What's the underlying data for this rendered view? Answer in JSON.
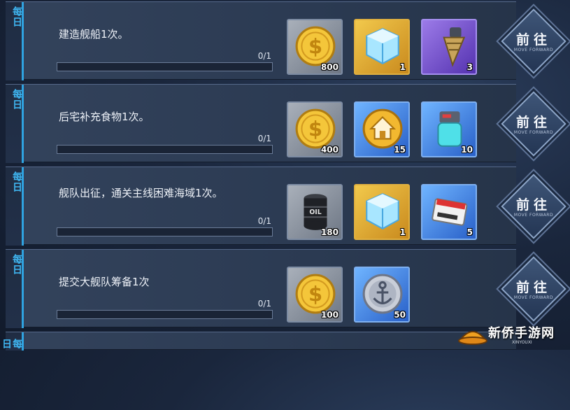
{
  "rows": [
    {
      "tag": "每日",
      "task": "建造舰船1次。",
      "progress": "0/1",
      "progress_fraction": 0,
      "rewards": [
        {
          "icon": "gold-coin-icon",
          "quantity": "800"
        },
        {
          "icon": "ice-cube-icon",
          "quantity": "1"
        },
        {
          "icon": "drill-icon",
          "quantity": "3"
        }
      ],
      "button": {
        "label": "前往",
        "sublabel": "MOVE FORWARD"
      }
    },
    {
      "tag": "每日",
      "task": "后宅补充食物1次。",
      "progress": "0/1",
      "progress_fraction": 0,
      "rewards": [
        {
          "icon": "gold-coin-icon",
          "quantity": "400"
        },
        {
          "icon": "home-icon",
          "quantity": "15"
        },
        {
          "icon": "canister-icon",
          "quantity": "10"
        }
      ],
      "button": {
        "label": "前往",
        "sublabel": "MOVE FORWARD"
      }
    },
    {
      "tag": "每日",
      "task": "舰队出征，通关主线困难海域1次。",
      "progress": "0/1",
      "progress_fraction": 0,
      "rewards": [
        {
          "icon": "oil-barrel-icon",
          "quantity": "180"
        },
        {
          "icon": "ice-cube-icon",
          "quantity": "1"
        },
        {
          "icon": "core-data-icon",
          "quantity": "5"
        }
      ],
      "button": {
        "label": "前往",
        "sublabel": "MOVE FORWARD"
      }
    },
    {
      "tag": "每日",
      "task": "提交大舰队筹备1次",
      "progress": "0/1",
      "progress_fraction": 0,
      "rewards": [
        {
          "icon": "gold-coin-icon",
          "quantity": "100"
        },
        {
          "icon": "anchor-medal-icon",
          "quantity": "50"
        }
      ],
      "button": {
        "label": "前往",
        "sublabel": "MOVE FORWARD"
      }
    },
    {
      "tag": "每日"
    }
  ],
  "watermark": {
    "text": "新侨手游网",
    "sub": "XINYOUXI"
  }
}
